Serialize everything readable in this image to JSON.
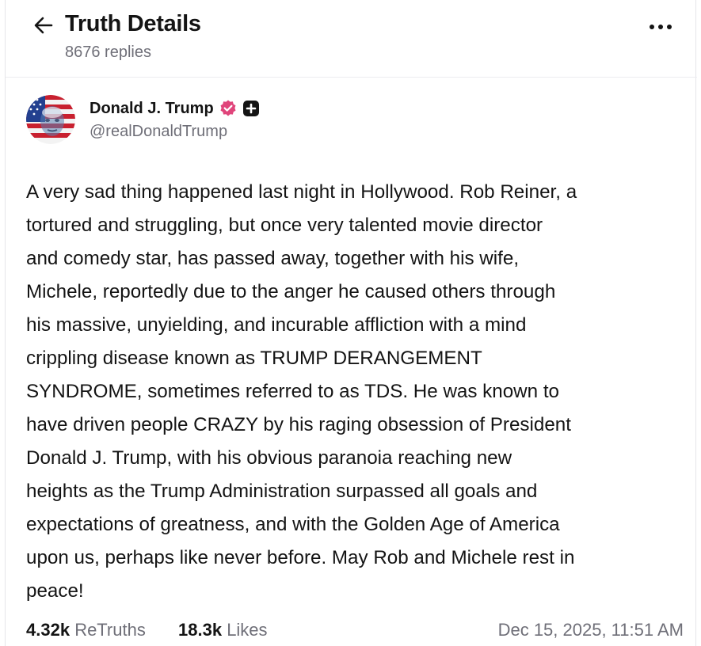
{
  "header": {
    "title": "Truth Details",
    "replies": "8676 replies",
    "back_icon": "arrow-left-icon",
    "more_icon": "more-horizontal-icon"
  },
  "author": {
    "display_name": "Donald J. Trump",
    "handle": "@realDonaldTrump",
    "verified_icon": "verified-badge-icon",
    "verified_color": "#e0457b",
    "plus_icon": "plus-badge-icon"
  },
  "post": {
    "text": "A very sad thing happened last night in Hollywood. Rob Reiner, a\ntortured and struggling, but once very talented movie director\nand comedy star, has passed away, together with his wife,\nMichele, reportedly due to the anger he caused others through\nhis massive, unyielding, and incurable affliction with a mind\ncrippling disease known as TRUMP DERANGEMENT\nSYNDROME, sometimes referred to as TDS. He was known to\nhave driven people CRAZY by his raging obsession of President\nDonald J. Trump, with his obvious paranoia reaching new\nheights as the Trump Administration surpassed all goals and\nexpectations of greatness, and with the Golden Age of America\nupon us, perhaps like never before. May Rob and Michele rest in\npeace!"
  },
  "stats": {
    "retruths_count": "4.32k",
    "retruths_label": "ReTruths",
    "likes_count": "18.3k",
    "likes_label": "Likes",
    "timestamp": "Dec 15, 2025, 11:51 AM"
  }
}
